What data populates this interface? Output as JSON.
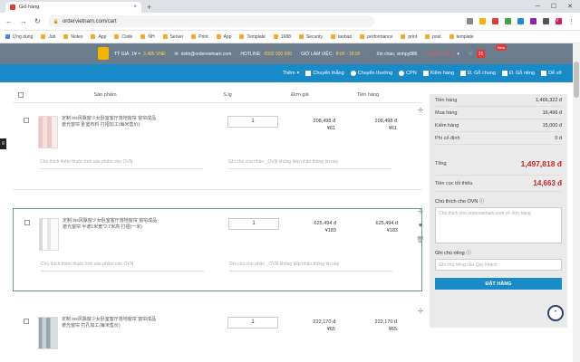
{
  "browser": {
    "tab_title": "Giỏ hàng",
    "url": "ordervietnam.com/cart",
    "avatar_letter": "V"
  },
  "bookmarks": [
    "Ứng dụng",
    "Job",
    "Notes",
    "App",
    "Code",
    "NH",
    "Server",
    "Print",
    "App",
    "Template",
    "1688",
    "Security",
    "taobao",
    "performance",
    "print",
    "post",
    "template"
  ],
  "topbar": {
    "rate_label": "TỶ GIÁ: 1¥ =",
    "rate_value": "3,485 VNĐ",
    "email": "dxkh@ordervietnam.com",
    "hotline_label": "HOTLINE:",
    "hotline_value": "0932 000 000",
    "hours_label": "GIỜ LÀM VIỆC:",
    "hours_value": "8:00 - 18:00",
    "greeting": "Xin chào, vinhpy886",
    "balance": "-12,667,722 đ",
    "cart_count": "21",
    "new_badge": "New"
  },
  "toolbar": {
    "add_label": "Thêm",
    "options": [
      "Chuyển thẳng",
      "Chuyển thường",
      "CPN",
      "Kiểm hàng",
      "Đ. Gỗ chung",
      "Đ. Gỗ riêng",
      "Dễ vỡ"
    ]
  },
  "table": {
    "headers": [
      "Sản phẩm",
      "S.lg",
      "Đơn giá",
      "Tiền hàng"
    ],
    "rows": [
      {
        "name": "定制 ins风飘窗少女卧室客厅落地窗帘 窗帘成品 遮光窗帘 卧室布料 打褶加工(每米售价)",
        "qty": "1",
        "price_vnd": "208,498 đ",
        "price_cny": "¥61",
        "total_vnd": "208,498 đ",
        "total_cny": "¥61",
        "note_ovn": "Chú thích thêm thuộc tính sản phẩm cho OVN",
        "note_seller": "Ghi chú cho nhân _OVN không tiếp nhận thông tin này"
      },
      {
        "name": "定制 ins风飘窗少女卧室客厅落地窗帘 窗帘成品 遮光窗帘 半遮1米宽*2.7米高 打褶(一米)",
        "qty": "1",
        "price_vnd": "625,494 đ",
        "price_cny": "¥183",
        "total_vnd": "625,494 đ",
        "total_cny": "¥183",
        "note_ovn": "Chú thích thêm thuộc tính sản phẩm cho OVN",
        "note_seller": "Ghi chú cho nhân _OVN không tiếp nhận thông tin này"
      },
      {
        "name": "定制 ins风飘窗少女卧室客厅落地窗帘 窗帘成品 遮光窗帘 打孔加工(每米售价)",
        "qty": "1",
        "price_vnd": "222,170 đ",
        "price_cny": "¥65",
        "total_vnd": "222,170 đ",
        "total_cny": "¥65",
        "note_ovn": "",
        "note_seller": ""
      }
    ]
  },
  "summary": {
    "tien_hang_label": "Tiền hàng",
    "tien_hang": "1,466,322 đ",
    "mua_hang_label": "Mua hàng",
    "mua_hang": "16,496 đ",
    "kiem_hang_label": "Kiểm hàng",
    "kiem_hang": "15,000 đ",
    "phi_co_dinh_label": "Phí cố định",
    "phi_co_dinh": "0 đ",
    "tong_label": "Tổng",
    "tong": "1,497,818 đ",
    "dat_coc_label": "Tiền cọc tối thiểu",
    "dat_coc": "14,663 đ",
    "note_ovn_label": "Chú thích cho OVN",
    "note_ovn_placeholder": "Chú thích cho ordervietnam.com về đơn hàng",
    "note_private_label": "Ghi chú riêng",
    "note_private_placeholder": "Ghi chú riêng của Quý khách",
    "order_button": "ĐẶT HÀNG"
  },
  "colors": {
    "toolbar_blue": "#1a8bc9",
    "topbar_grey": "#6b7c8c",
    "total_red": "#c62828"
  }
}
